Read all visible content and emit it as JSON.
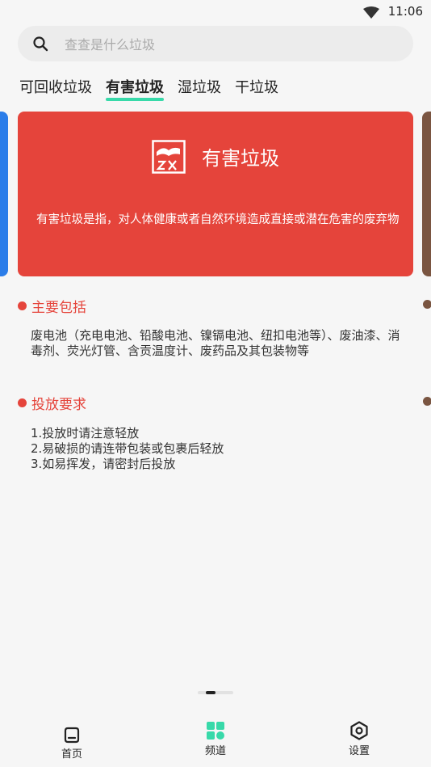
{
  "status_bar": {
    "time": "11:06",
    "wifi_icon": "wifi-icon"
  },
  "search": {
    "placeholder": "查查是什么垃圾",
    "value": "",
    "icon": "search-icon"
  },
  "tabs": [
    {
      "label": "可回收垃圾",
      "active": false
    },
    {
      "label": "有害垃圾",
      "active": true
    },
    {
      "label": "湿垃圾",
      "active": false
    },
    {
      "label": "干垃圾",
      "active": false
    }
  ],
  "card": {
    "title": "有害垃圾",
    "description": "有害垃圾是指，对人体健康或者自然环境造成直接或潜在危害的废弃物",
    "color": "#e5443b",
    "icon": "hazardous-waste-icon"
  },
  "sections": [
    {
      "heading": "主要包括",
      "body": [
        "废电池（充电电池、铅酸电池、镍镉电池、纽扣电池等）、废油漆、消毒剂、荧光灯管、含贡温度计、废药品及其包装物等"
      ]
    },
    {
      "heading": "投放要求",
      "body": [
        "1.投放时请注意轻放",
        "2.易破损的请连带包装或包裹后轻放",
        "3.如易挥发，请密封后投放"
      ]
    }
  ],
  "carousel": {
    "prev_color": "#2b7de9",
    "next_color": "#7a5541",
    "current_page": 2
  },
  "bottom_nav": [
    {
      "label": "首页",
      "icon": "home-icon",
      "active": false
    },
    {
      "label": "频道",
      "icon": "grid-icon",
      "active": true
    },
    {
      "label": "设置",
      "icon": "settings-icon",
      "active": false
    }
  ],
  "colors": {
    "accent": "#38d9a9",
    "hazard_red": "#e5443b"
  }
}
